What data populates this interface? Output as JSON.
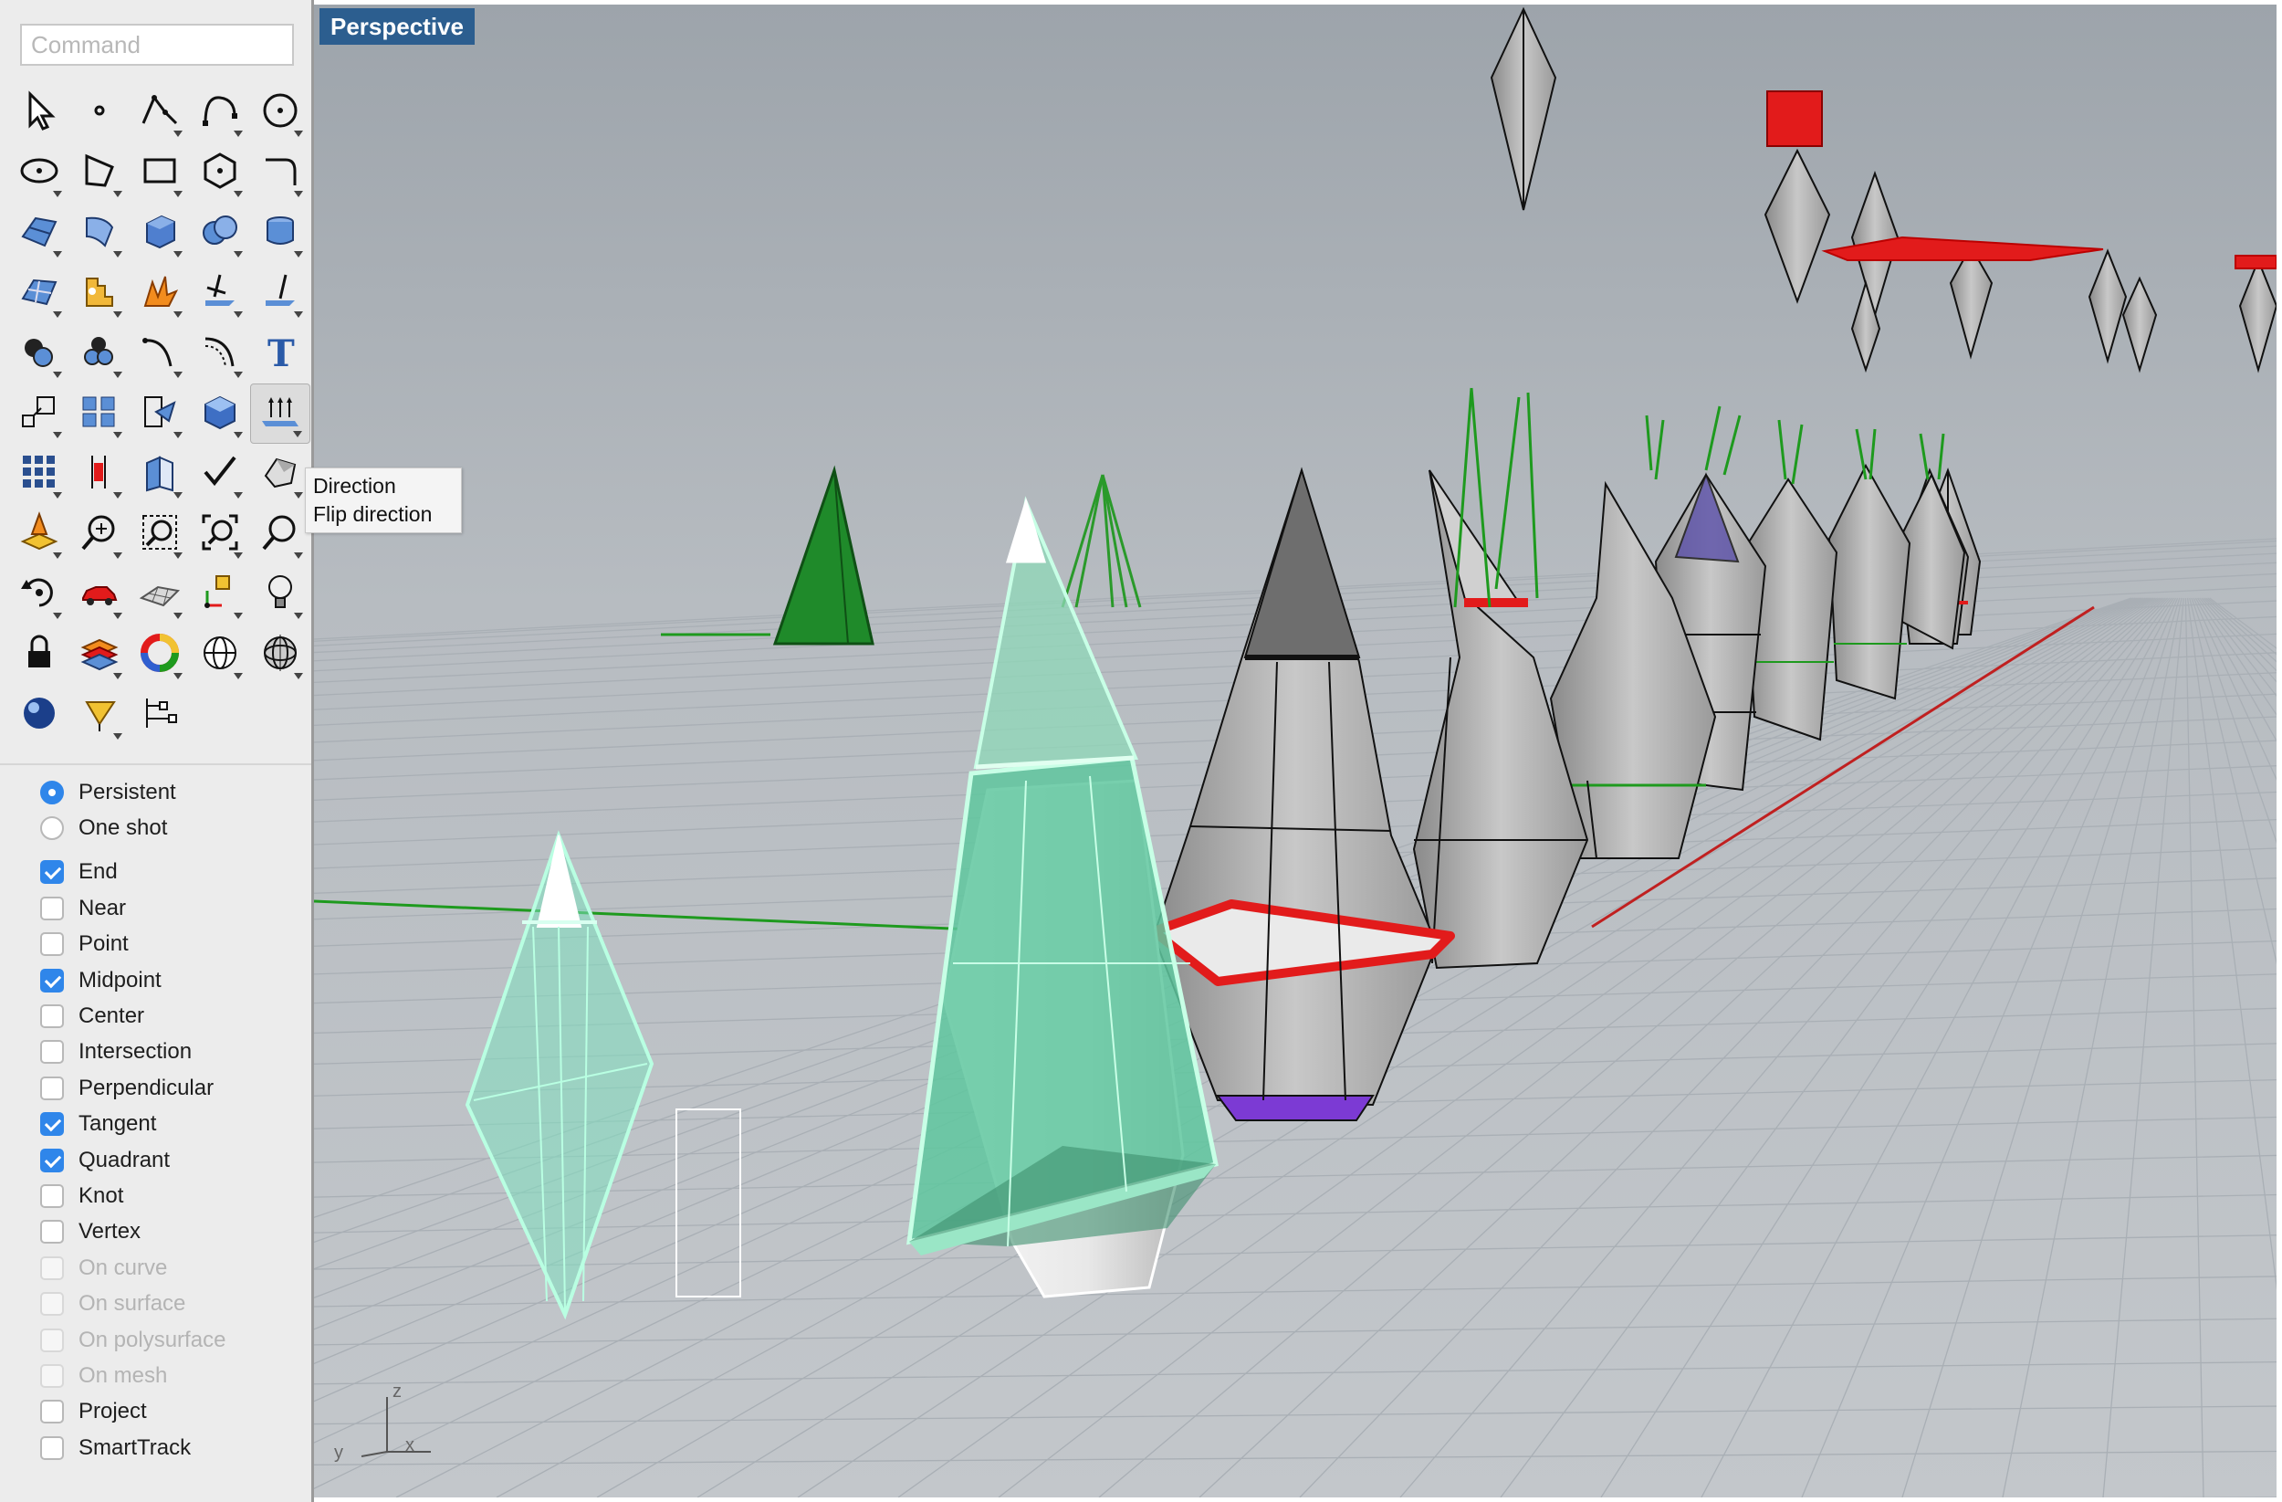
{
  "command": {
    "placeholder": "Command"
  },
  "toolbar": {
    "icons": [
      [
        "select-arrow-icon",
        "point-icon",
        "polyline-icon",
        "curve-icon",
        "circle-icon"
      ],
      [
        "ellipse-icon",
        "polygon-icon",
        "rectangle-icon",
        "hexagon-icon",
        "arc-fillet-icon"
      ],
      [
        "surface-from-points-icon",
        "extrude-surface-icon",
        "box-icon",
        "sphere-icon",
        "cylinder-icon"
      ],
      [
        "plane-grid-icon",
        "puzzle-icon",
        "explode-icon",
        "trim-icon",
        "split-icon"
      ],
      [
        "boolean-union-icon",
        "group-circles-icon",
        "fillet-curve-icon",
        "offset-curve-icon",
        "text-icon"
      ],
      [
        "scale-icon",
        "array-blocks-icon",
        "move-icon",
        "shaded-box-icon",
        "direction-icon"
      ],
      [
        "grid-array-icon",
        "dimension-icon",
        "sheets-icon",
        "check-icon",
        "analyze-shape-icon"
      ],
      [
        "cplane-icon",
        "zoom-in-icon",
        "zoom-window-icon",
        "zoom-extents-icon",
        "zoom-icon"
      ],
      [
        "rotate-view-icon",
        "car-icon",
        "grid-plane-icon",
        "gumball-icon",
        "light-bulb-icon"
      ],
      [
        "lock-icon",
        "layer-book-icon",
        "color-wheel-icon",
        "sphere-wire-icon",
        "sphere-grid-icon"
      ],
      [
        "render-ball-icon",
        "paint-cone-icon",
        "snap-tree-icon"
      ]
    ],
    "active_index": 29
  },
  "tooltip": {
    "line1": "Direction",
    "line2": "Flip direction"
  },
  "snap_mode": [
    {
      "label": "Persistent",
      "selected": true
    },
    {
      "label": "One shot",
      "selected": false
    }
  ],
  "osnaps": [
    {
      "label": "End",
      "checked": true,
      "enabled": true
    },
    {
      "label": "Near",
      "checked": false,
      "enabled": true
    },
    {
      "label": "Point",
      "checked": false,
      "enabled": true
    },
    {
      "label": "Midpoint",
      "checked": true,
      "enabled": true
    },
    {
      "label": "Center",
      "checked": false,
      "enabled": true
    },
    {
      "label": "Intersection",
      "checked": false,
      "enabled": true
    },
    {
      "label": "Perpendicular",
      "checked": false,
      "enabled": true
    },
    {
      "label": "Tangent",
      "checked": true,
      "enabled": true
    },
    {
      "label": "Quadrant",
      "checked": true,
      "enabled": true
    },
    {
      "label": "Knot",
      "checked": false,
      "enabled": true
    },
    {
      "label": "Vertex",
      "checked": false,
      "enabled": true
    },
    {
      "label": "On curve",
      "checked": false,
      "enabled": false
    },
    {
      "label": "On surface",
      "checked": false,
      "enabled": false
    },
    {
      "label": "On polysurface",
      "checked": false,
      "enabled": false
    },
    {
      "label": "On mesh",
      "checked": false,
      "enabled": false
    },
    {
      "label": "Project",
      "checked": false,
      "enabled": true
    },
    {
      "label": "SmartTrack",
      "checked": false,
      "enabled": true
    }
  ],
  "viewport": {
    "label": "Perspective",
    "axis_labels": {
      "x": "x",
      "y": "y",
      "z": "z"
    }
  },
  "colors": {
    "viewport_top": "#9da4ab",
    "viewport_bottom": "#c5c9cd",
    "grid": "#a7adb3",
    "selection_green": "#5fc79f",
    "highlight_red": "#e21b1b",
    "axis_green": "#1e9a1e",
    "purple": "#7c3ad4"
  }
}
